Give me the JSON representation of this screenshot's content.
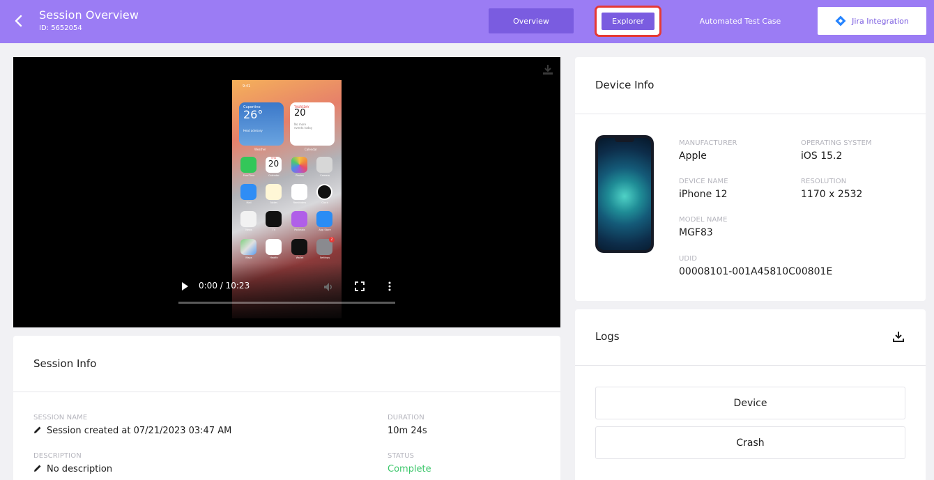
{
  "header": {
    "title": "Session Overview",
    "subtitle": "ID: 5652054",
    "tabs": {
      "overview": "Overview",
      "explorer": "Explorer",
      "automated": "Automated Test Case",
      "jira": "Jira Integration"
    }
  },
  "video": {
    "time": "0:00 / 10:23",
    "phone_screen": {
      "status_time": "9:41",
      "weather": {
        "city": "Cupertino",
        "temp": "26°",
        "note": "Heat advisory",
        "label": "Weather"
      },
      "calendar": {
        "day": "THURSDAY",
        "date": "20",
        "note1": "No more",
        "note2": "events today",
        "label": "Calendar"
      },
      "calendar_app_day": "THU",
      "calendar_app_date": "20",
      "settings_badge": "2",
      "apps": [
        "FaceTime",
        "Calendar",
        "Photos",
        "Camera",
        "Mail",
        "Notes",
        "Reminders",
        "Clock",
        "News",
        "TV",
        "Podcasts",
        "App Store",
        "Maps",
        "Health",
        "Wallet",
        "Settings"
      ]
    }
  },
  "session_info": {
    "title": "Session Info",
    "session_name_label": "SESSION NAME",
    "session_name": "Session created at 07/21/2023 03:47 AM",
    "duration_label": "DURATION",
    "duration": "10m 24s",
    "description_label": "DESCRIPTION",
    "description": "No description",
    "status_label": "STATUS",
    "status": "Complete"
  },
  "device_info": {
    "title": "Device Info",
    "manufacturer_label": "MANUFACTURER",
    "manufacturer": "Apple",
    "os_label": "OPERATING SYSTEM",
    "os": "iOS 15.2",
    "device_name_label": "DEVICE NAME",
    "device_name": "iPhone 12",
    "resolution_label": "RESOLUTION",
    "resolution": "1170 x 2532",
    "model_name_label": "MODEL NAME",
    "model_name": "MGF83",
    "udid_label": "UDID",
    "udid": "00008101-001A45810C00801E"
  },
  "logs": {
    "title": "Logs",
    "buttons": [
      "Device",
      "Crash"
    ]
  },
  "colors": {
    "header": "#9b7cf4",
    "accent": "#7a5ce0",
    "highlight": "#e53935",
    "status_complete": "#3cc76b"
  },
  "icons": [
    "chevron-left-icon",
    "jira-icon",
    "download-icon",
    "play-icon",
    "volume-icon",
    "fullscreen-icon",
    "more-vert-icon",
    "pencil-icon"
  ]
}
